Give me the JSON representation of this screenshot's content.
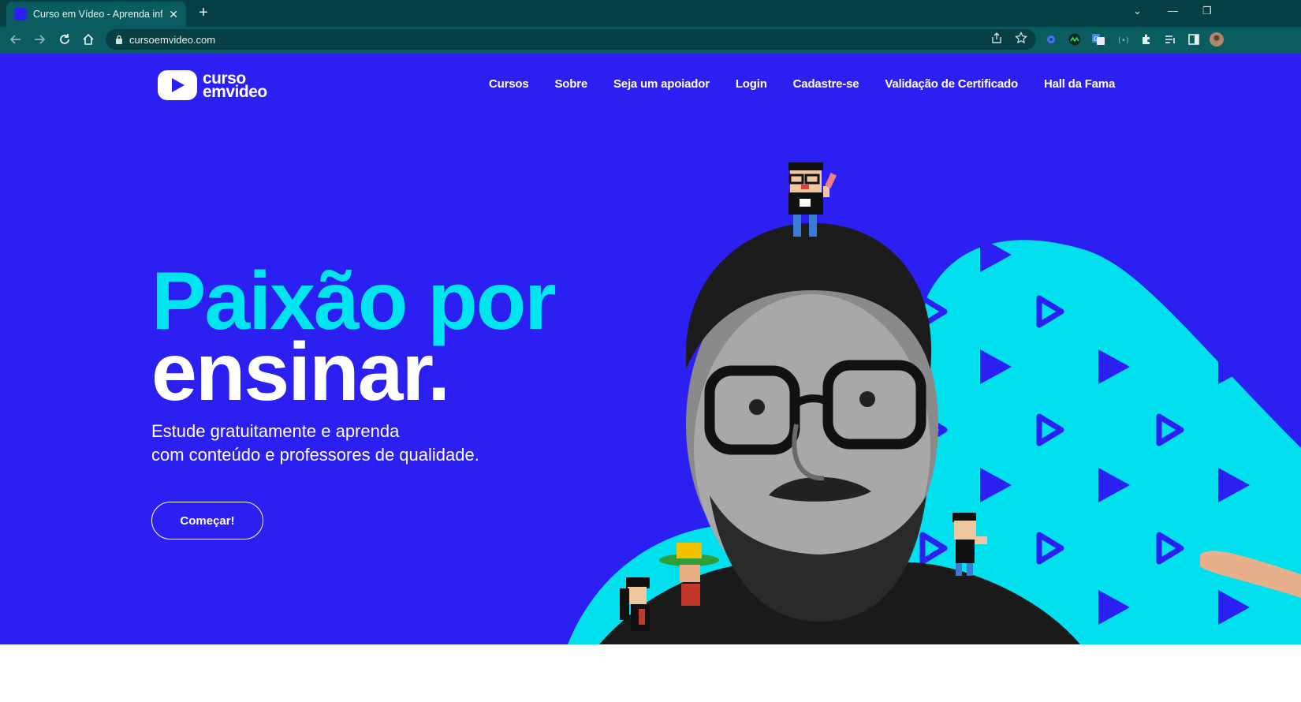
{
  "browser": {
    "tab_title": "Curso em Vídeo - Aprenda inform",
    "url": "cursoemvideo.com",
    "icons": [
      "back-icon",
      "forward-icon",
      "reload-icon",
      "home-icon",
      "lock-icon",
      "share-icon",
      "star-icon",
      "puzzle-icon",
      "reading-list-icon",
      "side-panel-icon",
      "avatar"
    ]
  },
  "site": {
    "logo_line1": "curso",
    "logo_line2": "emvideo",
    "nav": [
      "Cursos",
      "Sobre",
      "Seja um apoiador",
      "Login",
      "Cadastre-se",
      "Validação de Certificado",
      "Hall da Fama"
    ],
    "hero_line1": "Paixão por",
    "hero_line2": "ensinar.",
    "sub_line1": "Estude gratuitamente e aprenda",
    "sub_line2": "com conteúdo e professores de qualidade.",
    "cta": "Começar!"
  },
  "colors": {
    "background": "#2b1ff2",
    "accent": "#00e6f0",
    "chrome": "#0b5c61"
  }
}
